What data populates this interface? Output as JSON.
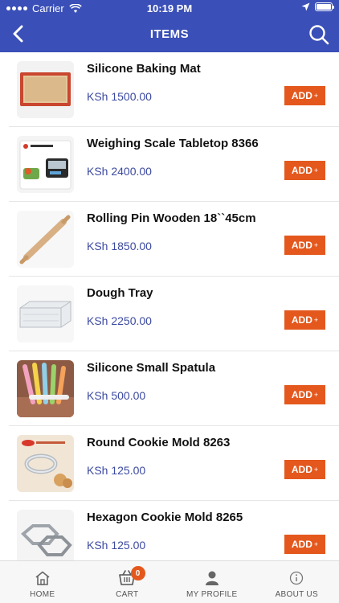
{
  "status_bar": {
    "carrier": "Carrier",
    "time": "10:19 PM"
  },
  "navbar": {
    "title": "ITEMS"
  },
  "items": [
    {
      "name": "Silicone Baking Mat",
      "price": "KSh 1500.00",
      "add_label": "ADD",
      "add_symbol": "+"
    },
    {
      "name": "Weighing Scale Tabletop 8366",
      "price": "KSh 2400.00",
      "add_label": "ADD",
      "add_symbol": "+"
    },
    {
      "name": "Rolling Pin Wooden 18``45cm",
      "price": "KSh 1850.00",
      "add_label": "ADD",
      "add_symbol": "+"
    },
    {
      "name": "Dough Tray",
      "price": "KSh 2250.00",
      "add_label": "ADD",
      "add_symbol": "+"
    },
    {
      "name": "Silicone Small Spatula",
      "price": "KSh 500.00",
      "add_label": "ADD",
      "add_symbol": "+"
    },
    {
      "name": "Round Cookie Mold 8263",
      "price": "KSh 125.00",
      "add_label": "ADD",
      "add_symbol": "+"
    },
    {
      "name": "Hexagon Cookie Mold 8265",
      "price": "KSh 125.00",
      "add_label": "ADD",
      "add_symbol": "+"
    }
  ],
  "tabbar": {
    "home": "HOME",
    "cart": "CART",
    "cart_count": "0",
    "profile": "MY PROFILE",
    "about": "ABOUT US"
  },
  "colors": {
    "primary": "#3a4fb7",
    "accent": "#e4581d",
    "price": "#3c4aa0"
  },
  "icons": [
    "back-arrow-icon",
    "search-icon",
    "home-icon",
    "cart-icon",
    "profile-icon",
    "info-icon"
  ]
}
